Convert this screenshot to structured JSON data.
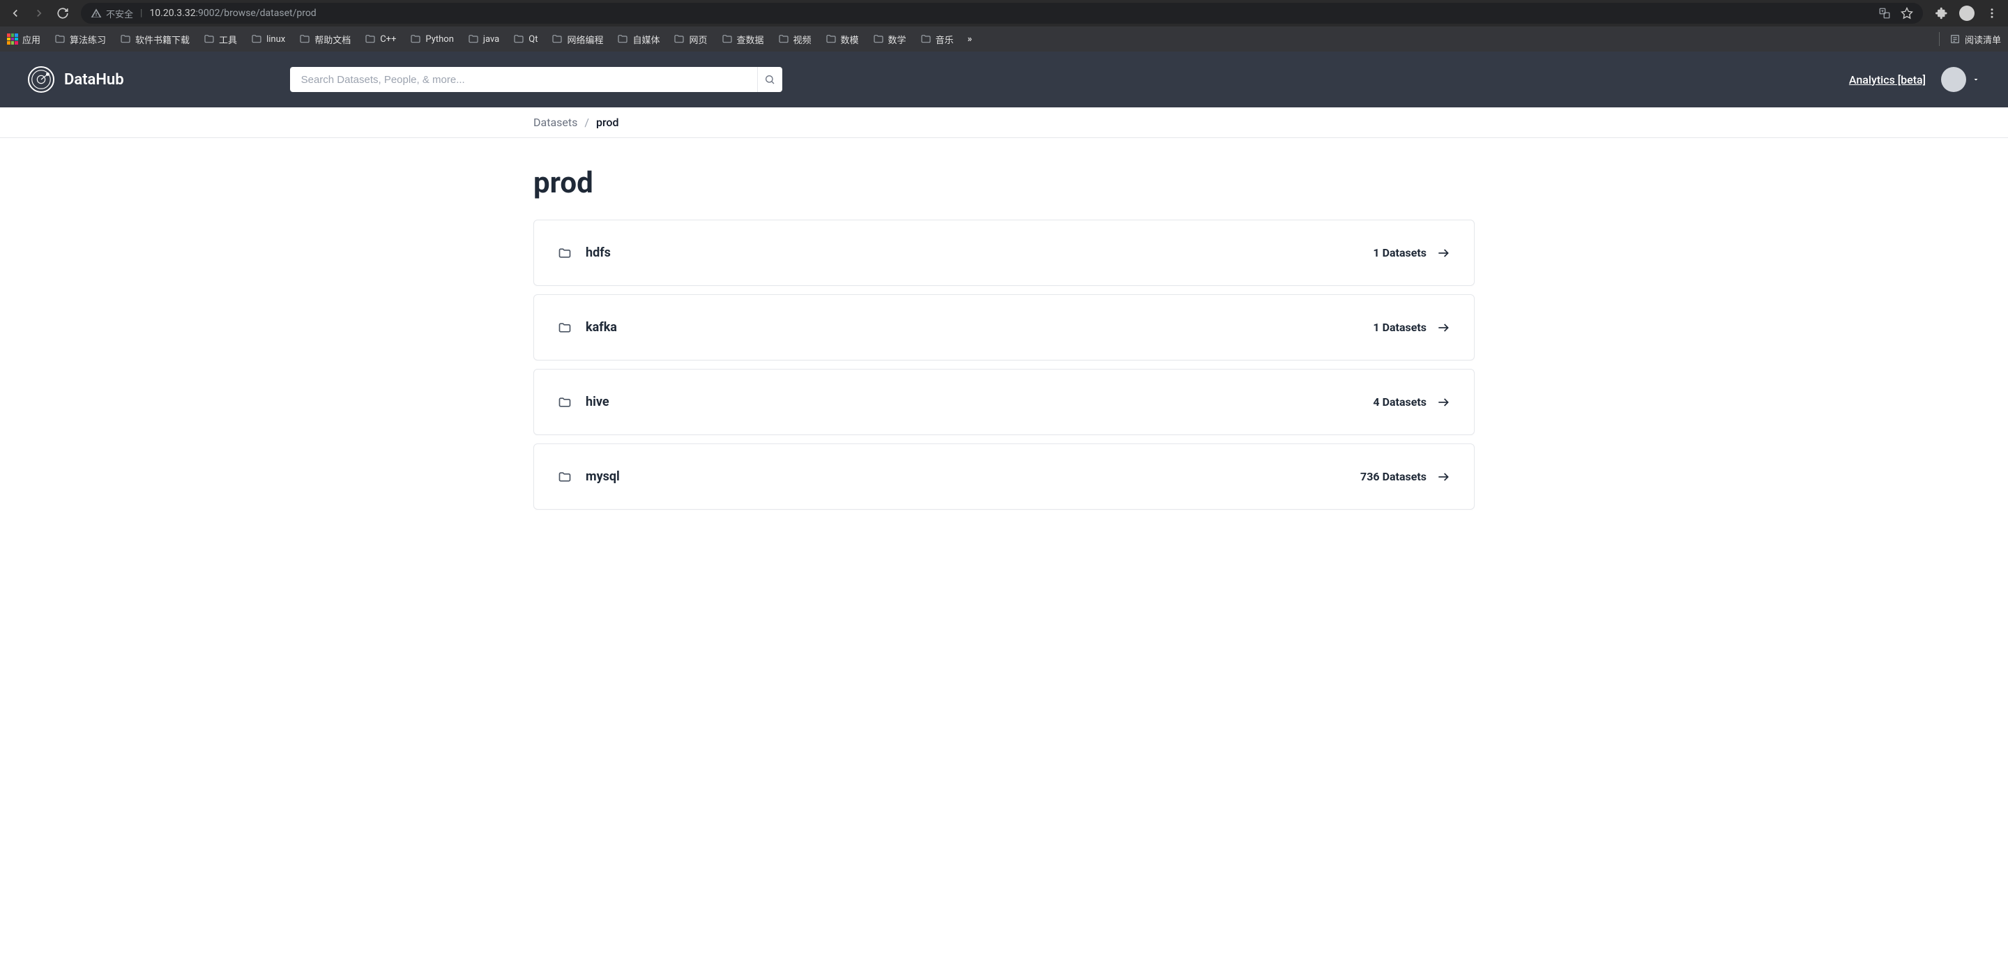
{
  "browser": {
    "insecure_label": "不安全",
    "url_host": "10.20.3.32",
    "url_port_path": ":9002/browse/dataset/prod"
  },
  "bookmarks": {
    "apps_label": "应用",
    "items": [
      {
        "label": "算法练习"
      },
      {
        "label": "软件书籍下载"
      },
      {
        "label": "工具"
      },
      {
        "label": "linux"
      },
      {
        "label": "帮助文档"
      },
      {
        "label": "C++"
      },
      {
        "label": "Python"
      },
      {
        "label": "java"
      },
      {
        "label": "Qt"
      },
      {
        "label": "网络编程"
      },
      {
        "label": "自媒体"
      },
      {
        "label": "网页"
      },
      {
        "label": "查数据"
      },
      {
        "label": "视频"
      },
      {
        "label": "数模"
      },
      {
        "label": "数学"
      },
      {
        "label": "音乐"
      }
    ],
    "reading_list": "阅读清单"
  },
  "header": {
    "brand": "DataHub",
    "search_placeholder": "Search Datasets, People, & more...",
    "analytics_label": "Analytics [beta]"
  },
  "breadcrumb": {
    "root": "Datasets",
    "sep": "/",
    "current": "prod"
  },
  "page": {
    "title": "prod"
  },
  "folders": [
    {
      "name": "hdfs",
      "count_label": "1 Datasets"
    },
    {
      "name": "kafka",
      "count_label": "1 Datasets"
    },
    {
      "name": "hive",
      "count_label": "4 Datasets"
    },
    {
      "name": "mysql",
      "count_label": "736 Datasets"
    }
  ]
}
